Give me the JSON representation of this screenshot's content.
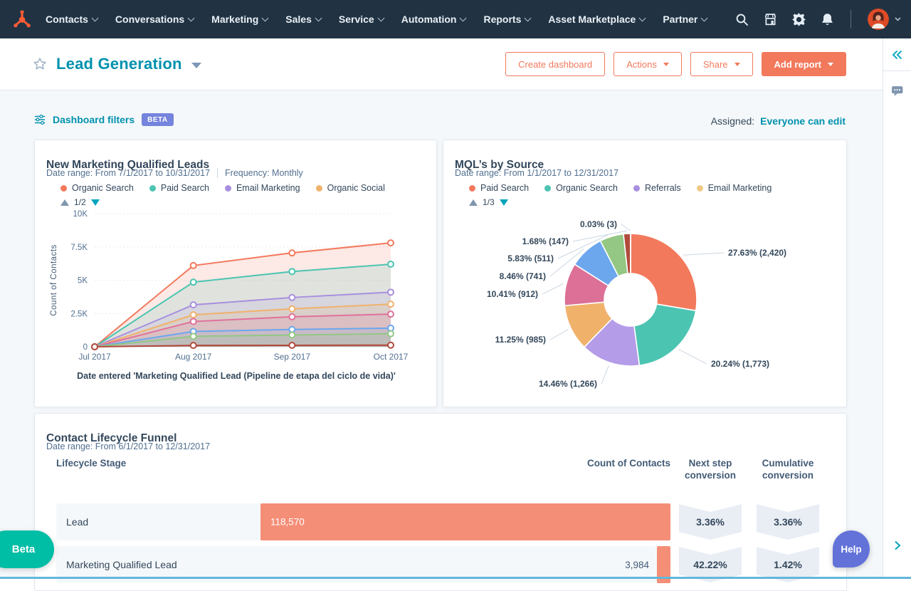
{
  "nav": {
    "items": [
      "Contacts",
      "Conversations",
      "Marketing",
      "Sales",
      "Service",
      "Automation",
      "Reports",
      "Asset Marketplace",
      "Partner"
    ]
  },
  "header": {
    "title": "Lead Generation",
    "buttons": {
      "create_dashboard": "Create dashboard",
      "actions": "Actions",
      "share": "Share",
      "add_report": "Add report"
    }
  },
  "filters": {
    "label": "Dashboard filters",
    "beta_badge": "BETA",
    "assigned_label": "Assigned:",
    "assigned_value": "Everyone can edit"
  },
  "fab": {
    "beta_label": "Beta",
    "help_label": "Help"
  },
  "icons": {
    "nav": [
      "search-icon",
      "marketplace-icon",
      "settings-icon",
      "notifications-icon",
      "account-caret-icon"
    ],
    "page": [
      "star-icon",
      "title-caret-icon",
      "filter-icon",
      "comments-icon",
      "collapse-panel-icon",
      "expand-chevron-icon",
      "legend-up-icon",
      "legend-down-icon"
    ]
  },
  "colors": {
    "nav_bg": "#213343",
    "accent_coral": "#f2795c",
    "teal_link": "#0091ae",
    "funnel_bar": "#f58e77",
    "beta_badge": "#7584dd",
    "beta_fab": "#00bda5",
    "help_fab": "#6272d9"
  },
  "chart_data": [
    {
      "type": "area",
      "title": "New Marketing Qualified Leads",
      "meta_date": "Date range: From 7/1/2017 to 10/31/2017",
      "meta_frequency": "Frequency: Monthly",
      "legend_page": "1/2",
      "legend_items": [
        {
          "label": "Organic Search",
          "color": "#f2795c"
        },
        {
          "label": "Paid Search",
          "color": "#4cc4b2"
        },
        {
          "label": "Email Marketing",
          "color": "#a78fe0"
        },
        {
          "label": "Organic Social",
          "color": "#f0b26b"
        }
      ],
      "x": [
        "Jul 2017",
        "Aug 2017",
        "Sep 2017",
        "Oct 2017"
      ],
      "xlabel": "Date entered 'Marketing Qualified Lead (Pipeline de etapa del ciclo de vida)'",
      "ylabel": "Count of Contacts",
      "ylim": [
        0,
        10000
      ],
      "yticks": [
        {
          "v": 0,
          "label": "0"
        },
        {
          "v": 2500,
          "label": "2.5K"
        },
        {
          "v": 5000,
          "label": "5K"
        },
        {
          "v": 7500,
          "label": "7.5K"
        },
        {
          "v": 10000,
          "label": "10K"
        }
      ],
      "series": [
        {
          "name": "Organic Search",
          "color": "#f2795c",
          "values": [
            0,
            6100,
            7050,
            7800
          ]
        },
        {
          "name": "Paid Search",
          "color": "#4cc4b2",
          "values": [
            0,
            4850,
            5650,
            6200
          ]
        },
        {
          "name": "Email Marketing",
          "color": "#a78fe0",
          "values": [
            0,
            3150,
            3700,
            4100
          ]
        },
        {
          "name": "Organic Social",
          "color": "#f0b26b",
          "values": [
            0,
            2400,
            2850,
            3200
          ]
        },
        {
          "name": "(legend page 2 - pink)",
          "color": "#e0719c",
          "values": [
            0,
            1900,
            2250,
            2450
          ]
        },
        {
          "name": "(legend page 2 - blue)",
          "color": "#6ca7ee",
          "values": [
            0,
            1150,
            1300,
            1400
          ]
        },
        {
          "name": "(legend page 2 - green)",
          "color": "#93c783",
          "values": [
            0,
            780,
            880,
            980
          ]
        },
        {
          "name": "(legend page 2 - dark red)",
          "color": "#b14a3c",
          "values": [
            0,
            100,
            110,
            120
          ]
        }
      ]
    },
    {
      "type": "pie",
      "title": "MQL’s by Source",
      "meta_date": "Date range: From 1/1/2017 to 12/31/2017",
      "legend_page": "1/3",
      "legend_items": [
        {
          "label": "Paid Search",
          "color": "#f2795c"
        },
        {
          "label": "Organic Search",
          "color": "#4cc4b2"
        },
        {
          "label": "Referrals",
          "color": "#a78fe0"
        },
        {
          "label": "Email Marketing",
          "color": "#f0c987"
        }
      ],
      "slices": [
        {
          "label": "27.63% (2,420)",
          "pct": 27.63,
          "value": 2420,
          "color": "#f2795c"
        },
        {
          "label": "20.24% (1,773)",
          "pct": 20.24,
          "value": 1773,
          "color": "#4cc4b2"
        },
        {
          "label": "14.46% (1,266)",
          "pct": 14.46,
          "value": 1266,
          "color": "#b49ce8"
        },
        {
          "label": "11.25% (985)",
          "pct": 11.25,
          "value": 985,
          "color": "#f0b26b"
        },
        {
          "label": "10.41% (912)",
          "pct": 10.41,
          "value": 912,
          "color": "#dc7096"
        },
        {
          "label": "8.46% (741)",
          "pct": 8.46,
          "value": 741,
          "color": "#6ca7ee"
        },
        {
          "label": "5.83% (511)",
          "pct": 5.83,
          "value": 511,
          "color": "#93c783"
        },
        {
          "label": "1.68% (147)",
          "pct": 1.68,
          "value": 147,
          "color": "#b14a3c"
        },
        {
          "label": "0.03% (3)",
          "pct": 0.03,
          "value": 3,
          "color": "#8a4a3a"
        }
      ]
    },
    {
      "type": "table",
      "title": "Contact Lifecycle Funnel",
      "meta_date": "Date range: From 6/1/2017 to 12/31/2017",
      "columns": [
        "Lifecycle Stage",
        "Count of Contacts",
        "Next step conversion",
        "Cumulative conversion"
      ],
      "rows": [
        {
          "stage": "Lead",
          "count": "118,570",
          "count_val": 118570,
          "next_step": "3.36%",
          "cumulative": "3.36%"
        },
        {
          "stage": "Marketing Qualified Lead",
          "count": "3,984",
          "count_val": 3984,
          "next_step": "42.22%",
          "cumulative": "1.42%"
        }
      ]
    }
  ]
}
